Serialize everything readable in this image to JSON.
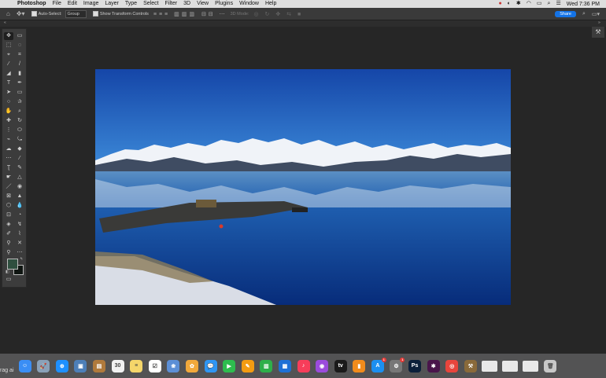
{
  "menubar": {
    "apple": "",
    "items": [
      "Photoshop",
      "File",
      "Edit",
      "Image",
      "Layer",
      "Type",
      "Select",
      "Filter",
      "3D",
      "View",
      "Plugins",
      "Window",
      "Help"
    ],
    "clock": "Wed 7:36 PM"
  },
  "options": {
    "auto_select_label": "Auto-Select:",
    "auto_select_value": "Group",
    "transform_label": "Show Transform Controls",
    "mode_3d": "3D Mode:",
    "share_label": "Share"
  },
  "dock": {
    "partial_text": "rag ai",
    "apps": [
      {
        "name": "finder",
        "color": "#3a8ef5",
        "glyph": "☺"
      },
      {
        "name": "launchpad",
        "color": "#8aa1b8",
        "glyph": "🚀"
      },
      {
        "name": "safari",
        "color": "#1e90ff",
        "glyph": "⊕"
      },
      {
        "name": "preview",
        "color": "#4d7fb8",
        "glyph": "▣"
      },
      {
        "name": "notefile",
        "color": "#b07a3c",
        "glyph": "▤"
      },
      {
        "name": "calendar",
        "color": "#f2f2f2",
        "glyph": "30"
      },
      {
        "name": "notes",
        "color": "#f5d66a",
        "glyph": "≡"
      },
      {
        "name": "reminders",
        "color": "#ffffff",
        "glyph": "☑"
      },
      {
        "name": "photos-viewer",
        "color": "#5c8fd6",
        "glyph": "❀"
      },
      {
        "name": "photos",
        "color": "#f2a93b",
        "glyph": "✿"
      },
      {
        "name": "messages",
        "color": "#2f96f3",
        "glyph": "💬"
      },
      {
        "name": "facetime",
        "color": "#2ebd4e",
        "glyph": "▶"
      },
      {
        "name": "pages",
        "color": "#f39c12",
        "glyph": "✎"
      },
      {
        "name": "numbers",
        "color": "#2eaf4a",
        "glyph": "▥"
      },
      {
        "name": "keynote",
        "color": "#1e70d6",
        "glyph": "▦"
      },
      {
        "name": "music",
        "color": "#f73d5a",
        "glyph": "♪"
      },
      {
        "name": "podcasts",
        "color": "#9b4bdc",
        "glyph": "◉"
      },
      {
        "name": "apple-tv",
        "color": "#1a1a1a",
        "glyph": "tv"
      },
      {
        "name": "books",
        "color": "#f28c1c",
        "glyph": "▮"
      },
      {
        "name": "app-store",
        "color": "#1c8ff0",
        "glyph": "A",
        "badge": "1"
      },
      {
        "name": "system-preferences",
        "color": "#777777",
        "glyph": "⚙",
        "badge": "1"
      },
      {
        "name": "photoshop",
        "color": "#0a1f3a",
        "glyph": "Ps"
      },
      {
        "name": "slack",
        "color": "#4a154b",
        "glyph": "✱"
      },
      {
        "name": "chrome",
        "color": "#e8453c",
        "glyph": "◎"
      },
      {
        "name": "unarchiver",
        "color": "#8a6a3a",
        "glyph": "⚒"
      }
    ]
  }
}
